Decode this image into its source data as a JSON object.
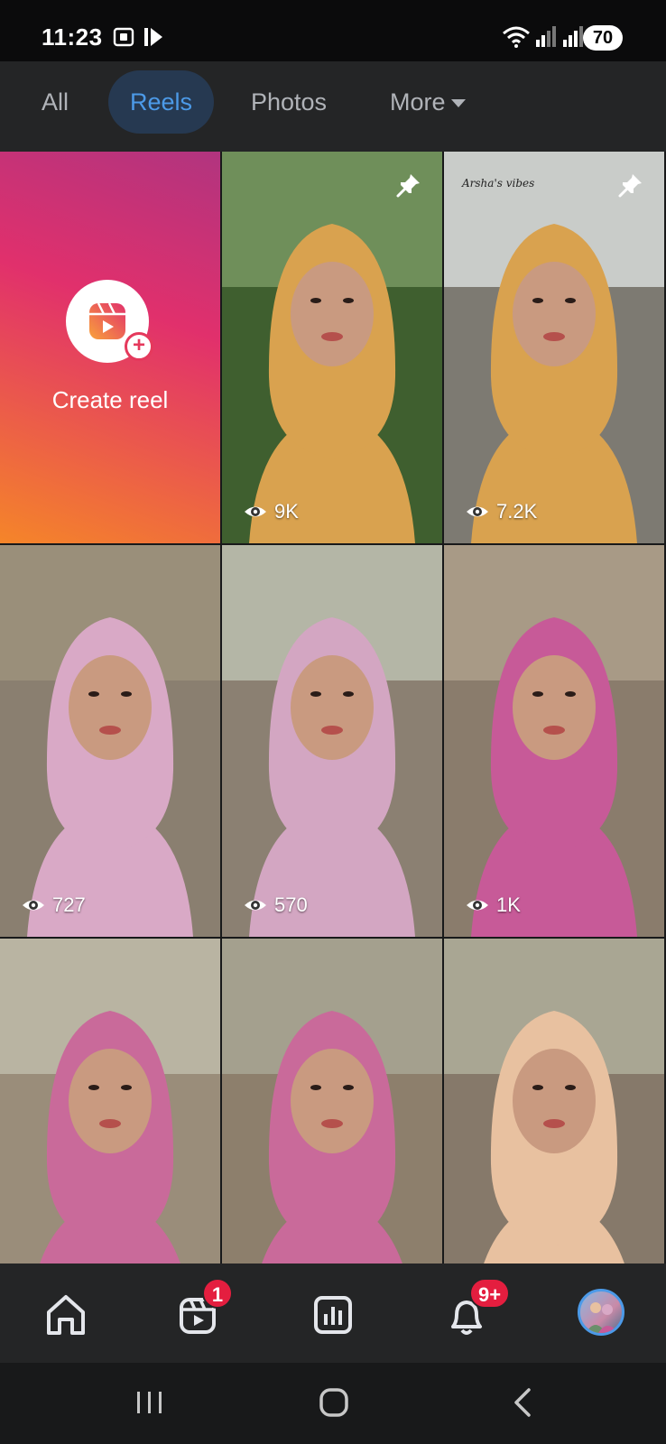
{
  "status_bar": {
    "time": "11:23",
    "battery": "70",
    "icons": [
      "screenshot-icon",
      "media-icon",
      "wifi-icon",
      "signal-icon",
      "signal-icon"
    ]
  },
  "tabs": [
    {
      "label": "All",
      "active": false
    },
    {
      "label": "Reels",
      "active": true
    },
    {
      "label": "Photos",
      "active": false
    },
    {
      "label": "More",
      "active": false
    }
  ],
  "create_reel": {
    "label": "Create reel",
    "icon": "reels-icon"
  },
  "reels": [
    {
      "views": "9K",
      "pinned": true,
      "scarf": "#d9a24f"
    },
    {
      "views": "7.2K",
      "pinned": true,
      "scarf": "#d9a24f",
      "overlay_text": "Arsha's vibes"
    },
    {
      "views": "727",
      "pinned": false,
      "scarf": "#d9a9c6"
    },
    {
      "views": "570",
      "pinned": false,
      "scarf": "#d3a6c2"
    },
    {
      "views": "1K",
      "pinned": false,
      "scarf": "#c75a98"
    },
    {
      "views": "",
      "pinned": false,
      "scarf": "#c96a9a"
    },
    {
      "views": "",
      "pinned": false,
      "scarf": "#c96a9a"
    },
    {
      "views": "",
      "pinned": false,
      "scarf": "#e8c1a0"
    }
  ],
  "bottom_nav": {
    "items": [
      "home-icon",
      "reels-icon",
      "insights-icon",
      "notifications-icon",
      "profile-avatar"
    ],
    "reels_badge": "1",
    "notifications_badge": "9+"
  },
  "colors": {
    "accent": "#4c9ae8",
    "badge": "#e41e3f",
    "background": "#18191a",
    "surface": "#242526"
  }
}
